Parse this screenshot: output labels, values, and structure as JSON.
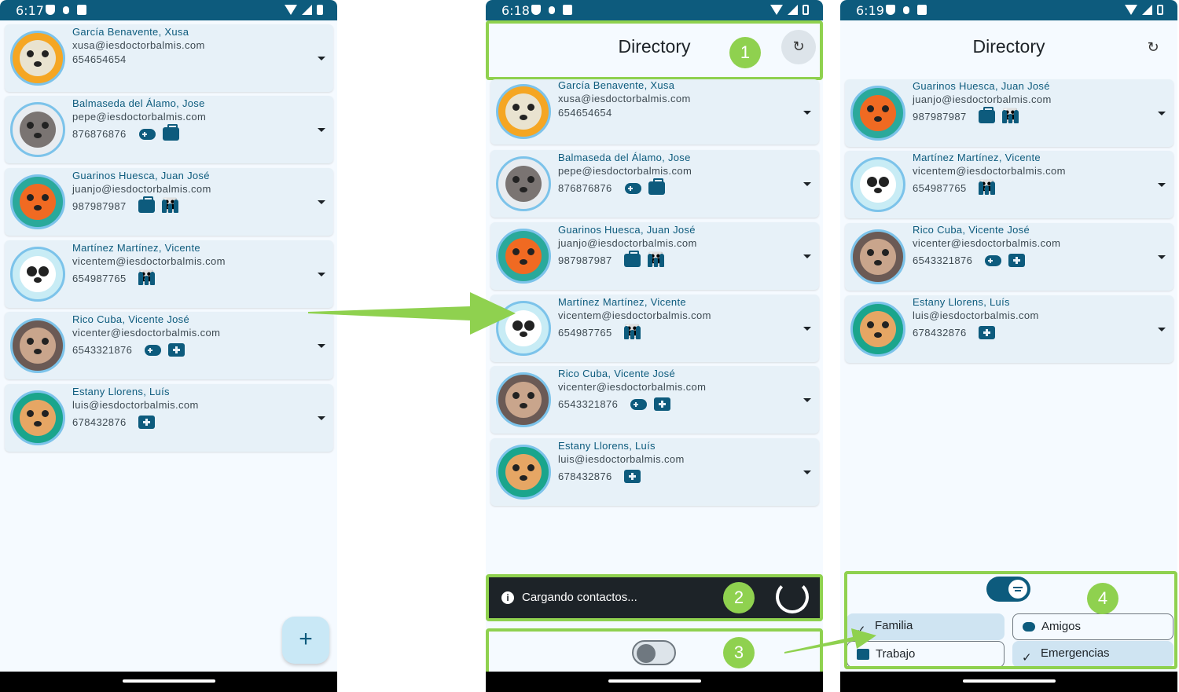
{
  "screens": [
    {
      "time": "6:17",
      "contacts": [
        {
          "name": "García Benavente, Xusa",
          "email": "xusa@iesdoctorbalmis.com",
          "phone": "654654654",
          "tags": [],
          "avatar": "owl-avatar"
        },
        {
          "name": "Balmaseda del Álamo, Jose",
          "email": "pepe@iesdoctorbalmis.com",
          "phone": "876876876",
          "tags": [
            "gamepad-icon",
            "briefcase-icon"
          ],
          "avatar": "wolf-avatar"
        },
        {
          "name": "Guarinos Huesca, Juan José",
          "email": "juanjo@iesdoctorbalmis.com",
          "phone": "987987987",
          "tags": [
            "briefcase-icon",
            "family-icon"
          ],
          "avatar": "fox-avatar"
        },
        {
          "name": "Martínez Martínez, Vicente",
          "email": "vicentem@iesdoctorbalmis.com",
          "phone": "654987765",
          "tags": [
            "family-icon"
          ],
          "avatar": "panda-avatar"
        },
        {
          "name": "Rico Cuba, Vicente José",
          "email": "vicenter@iesdoctorbalmis.com",
          "phone": "6543321876",
          "tags": [
            "gamepad-icon",
            "medical-icon"
          ],
          "avatar": "monkey-avatar"
        },
        {
          "name": "Estany Llorens, Luís",
          "email": "luis@iesdoctorbalmis.com",
          "phone": "678432876",
          "tags": [
            "medical-icon"
          ],
          "avatar": "kangaroo-avatar"
        }
      ],
      "fab_label": "+"
    },
    {
      "time": "6:18",
      "title": "Directory",
      "refresh_icon": "refresh-icon",
      "contacts": [
        {
          "name": "García Benavente, Xusa",
          "email": "xusa@iesdoctorbalmis.com",
          "phone": "654654654",
          "tags": []
        },
        {
          "name": "Balmaseda del Álamo, Jose",
          "email": "pepe@iesdoctorbalmis.com",
          "phone": "876876876",
          "tags": [
            "gamepad-icon",
            "briefcase-icon"
          ]
        },
        {
          "name": "Guarinos Huesca, Juan José",
          "email": "juanjo@iesdoctorbalmis.com",
          "phone": "987987987",
          "tags": [
            "briefcase-icon",
            "family-icon"
          ]
        },
        {
          "name": "Martínez Martínez, Vicente",
          "email": "vicentem@iesdoctorbalmis.com",
          "phone": "654987765",
          "tags": [
            "family-icon"
          ]
        },
        {
          "name": "Rico Cuba, Vicente José",
          "email": "vicenter@iesdoctorbalmis.com",
          "phone": "6543321876",
          "tags": [
            "gamepad-icon",
            "medical-icon"
          ]
        },
        {
          "name": "Estany Llorens, Luís",
          "email": "luis@iesdoctorbalmis.com",
          "phone": "678432876",
          "tags": [
            "medical-icon"
          ]
        }
      ],
      "snackbar": "Cargando contactos...",
      "badges": [
        "1",
        "2",
        "3"
      ]
    },
    {
      "time": "6:19",
      "title": "Directory",
      "contacts": [
        {
          "name": "Guarinos Huesca, Juan José",
          "email": "juanjo@iesdoctorbalmis.com",
          "phone": "987987987",
          "tags": [
            "briefcase-icon",
            "family-icon"
          ]
        },
        {
          "name": "Martínez Martínez, Vicente",
          "email": "vicentem@iesdoctorbalmis.com",
          "phone": "654987765",
          "tags": [
            "family-icon"
          ]
        },
        {
          "name": "Rico Cuba, Vicente José",
          "email": "vicenter@iesdoctorbalmis.com",
          "phone": "6543321876",
          "tags": [
            "gamepad-icon",
            "medical-icon"
          ]
        },
        {
          "name": "Estany Llorens, Luís",
          "email": "luis@iesdoctorbalmis.com",
          "phone": "678432876",
          "tags": [
            "medical-icon"
          ]
        }
      ],
      "filters": [
        {
          "label": "Familia",
          "selected": true
        },
        {
          "label": "Amigos",
          "selected": false
        },
        {
          "label": "Trabajo",
          "selected": false
        },
        {
          "label": "Emergencias",
          "selected": true
        }
      ],
      "badge": "4"
    }
  ],
  "colors": {
    "accent": "#0d5b7d",
    "highlight": "#8fd14f",
    "card": "#e7f1f8",
    "background": "#f5faff"
  }
}
